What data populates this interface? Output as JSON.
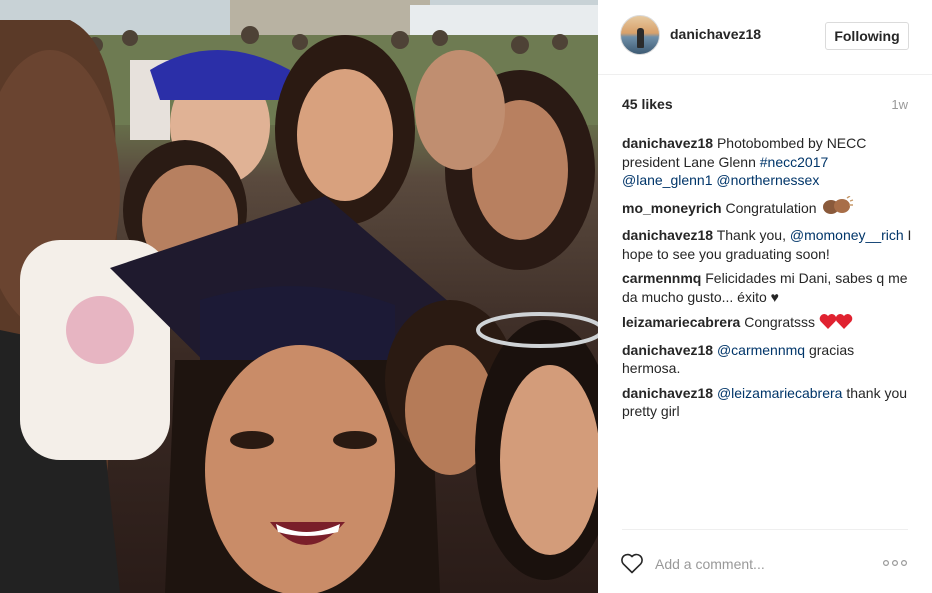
{
  "photo": {
    "description_icon": "group-selfie-photo"
  },
  "header": {
    "username": "danichavez18",
    "follow_label": "Following"
  },
  "stats": {
    "likes": "45 likes",
    "age": "1w"
  },
  "comments": [
    {
      "user": "danichavez18",
      "parts": [
        {
          "text": "Photobombed by NECC president Lane Glenn "
        },
        {
          "link": "#necc2017"
        },
        {
          "text": " "
        },
        {
          "link": "@lane_glenn1"
        },
        {
          "text": " "
        },
        {
          "link": "@northernessex"
        }
      ]
    },
    {
      "user": "mo_moneyrich",
      "parts": [
        {
          "text": "Congratulation "
        }
      ],
      "emoji": "clapping-hands-icon"
    },
    {
      "user": "danichavez18",
      "parts": [
        {
          "text": "Thank you, "
        },
        {
          "link": "@momoney__rich"
        },
        {
          "text": " I hope to see you graduating soon!"
        }
      ]
    },
    {
      "user": "carmennmq",
      "parts": [
        {
          "text": "Felicidades mi Dani, sabes q me da mucho gusto... éxito ♥"
        }
      ]
    },
    {
      "user": "leizamariecabrera",
      "parts": [
        {
          "text": "Congratsss "
        }
      ],
      "emoji": "two-red-hearts-icon"
    },
    {
      "user": "danichavez18",
      "parts": [
        {
          "link": "@carmennmq"
        },
        {
          "text": " gracias hermosa."
        }
      ]
    },
    {
      "user": "danichavez18",
      "parts": [
        {
          "link": "@leizamariecabrera"
        },
        {
          "text": " thank you pretty girl"
        }
      ]
    }
  ],
  "composer": {
    "placeholder": "Add a comment..."
  },
  "colors": {
    "link": "#003569",
    "text": "#262626",
    "muted": "#999999",
    "heart": "#ed4956"
  }
}
